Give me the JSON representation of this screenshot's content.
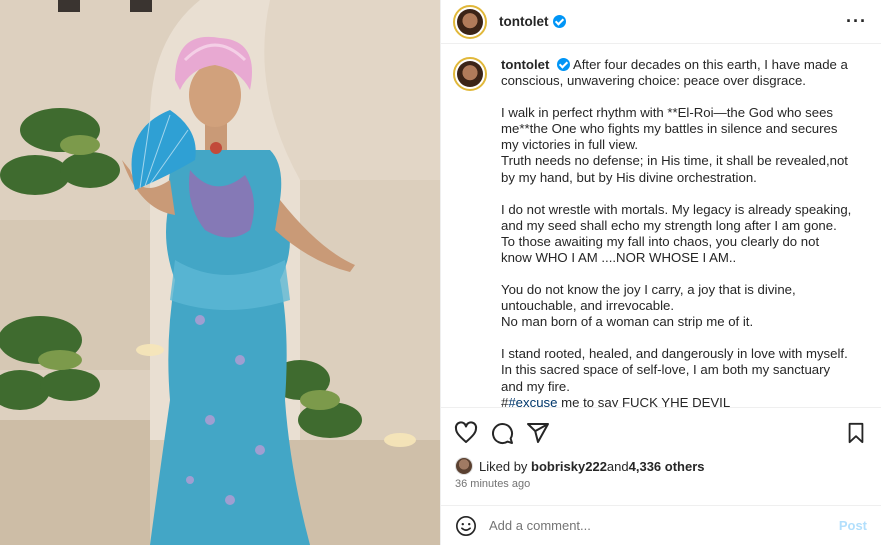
{
  "post": {
    "username": "tontolet",
    "more_icon": "more-horizontal-icon",
    "caption_paragraphs": [
      "After four decades on this earth, I have made a conscious, unwavering choice: peace over disgrace.",
      "I walk in perfect rhythm with **El-Roi—the God who sees me**the One who fights my battles in silence and secures my victories in full view.\nTruth needs no defense; in His time, it shall be revealed,not by my hand, but by His divine orchestration.",
      "I do not wrestle with mortals. My legacy is already speaking, and my seed shall echo my strength long after I am gone.\nTo those awaiting my fall into chaos, you clearly do not know WHO I AM ....NOR WHOSE I AM..",
      "You do not know the joy I carry, a joy that is divine, untouchable, and irrevocable.\nNo man born of a woman can strip me of it.",
      "I stand rooted, healed, and dangerously in love with myself. In this sacred space of self-love, I am both my sanctuary and my fire."
    ],
    "hashtag_prefix": "#",
    "hashtag": "#excuse",
    "hashtag_rest": " me to say FUCK YHE DEVIL",
    "liked_by_prefix": "Liked by ",
    "liked_by_user": "bobrisky222",
    "liked_by_and": " and ",
    "likes_count": "4,336 others",
    "time_ago": "36 minutes ago",
    "comment_placeholder": "Add a comment...",
    "post_label": "Post"
  }
}
